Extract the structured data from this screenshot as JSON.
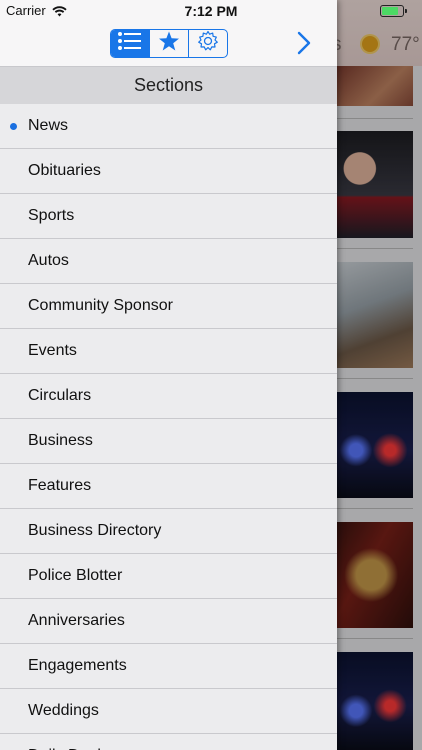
{
  "status_bar": {
    "carrier": "Carrier",
    "time": "7:12 PM",
    "battery_level": 0.9
  },
  "background": {
    "weather_temp": "77°",
    "weather_partial_text": "s"
  },
  "toolbar": {
    "segments": [
      {
        "icon": "list-icon",
        "active": true
      },
      {
        "icon": "star-icon",
        "active": false
      },
      {
        "icon": "gear-icon",
        "active": false
      }
    ],
    "forward_icon": "chevron-right-icon",
    "accent_color": "#1976e8"
  },
  "sections": {
    "title": "Sections",
    "selected_index": 0,
    "items": [
      {
        "label": "News"
      },
      {
        "label": "Obituaries"
      },
      {
        "label": "Sports"
      },
      {
        "label": "Autos"
      },
      {
        "label": "Community Sponsor"
      },
      {
        "label": "Events"
      },
      {
        "label": "Circulars"
      },
      {
        "label": "Business"
      },
      {
        "label": "Features"
      },
      {
        "label": "Business Directory"
      },
      {
        "label": "Police Blotter"
      },
      {
        "label": "Anniversaries"
      },
      {
        "label": "Engagements"
      },
      {
        "label": "Weddings"
      },
      {
        "label": "Daily Deals"
      }
    ]
  }
}
